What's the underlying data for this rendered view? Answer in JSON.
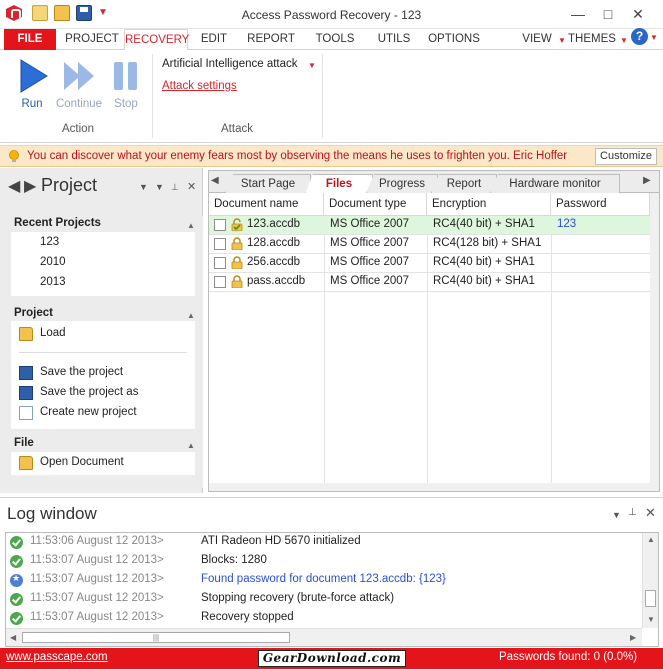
{
  "window": {
    "title": "Access Password Recovery - 123",
    "controls": {
      "minimize": "—",
      "maximize": "□",
      "close": "✕"
    }
  },
  "ribbon_tabs": [
    {
      "label": "FILE"
    },
    {
      "label": "PROJECT"
    },
    {
      "label": "RECOVERY",
      "active": true
    },
    {
      "label": "EDIT"
    },
    {
      "label": "REPORT"
    },
    {
      "label": "TOOLS"
    },
    {
      "label": "UTILS"
    },
    {
      "label": "OPTIONS"
    },
    {
      "label": "VIEW"
    },
    {
      "label": "THEMES"
    }
  ],
  "help": {
    "label": "?"
  },
  "ribbon": {
    "action_group": {
      "label": "Action",
      "run": "Run",
      "continue": "Continue",
      "stop": "Stop"
    },
    "attack_group": {
      "label": "Attack",
      "attack_type": "Artificial Intelligence attack",
      "settings_link": "Attack settings"
    }
  },
  "tip": {
    "text": "You can discover what your enemy fears most by observing the means he uses to frighten you. Eric Hoffer",
    "customize_label": "Customize"
  },
  "left_panel": {
    "title": "Project",
    "recent": {
      "heading": "Recent Projects",
      "items": [
        "123",
        "2010",
        "2013"
      ]
    },
    "project": {
      "heading": "Project",
      "items": [
        "Load",
        "Save the project",
        "Save the project as",
        "Create new project"
      ]
    },
    "file": {
      "heading": "File",
      "items": [
        "Open Document"
      ]
    }
  },
  "doc_tabs": [
    {
      "label": "Start Page"
    },
    {
      "label": "Files",
      "active": true
    },
    {
      "label": "Progress"
    },
    {
      "label": "Report"
    },
    {
      "label": "Hardware monitor"
    }
  ],
  "files_table": {
    "columns": [
      "Document name",
      "Document type",
      "Encryption",
      "Password"
    ],
    "rows": [
      {
        "name": "123.accdb",
        "type": "MS Office 2007",
        "encryption": "RC4(40 bit) + SHA1",
        "password": "123",
        "found": true
      },
      {
        "name": "128.accdb",
        "type": "MS Office 2007",
        "encryption": "RC4(128 bit) + SHA1",
        "password": "",
        "found": false
      },
      {
        "name": "256.accdb",
        "type": "MS Office 2007",
        "encryption": "RC4(40 bit) + SHA1",
        "password": "",
        "found": false
      },
      {
        "name": "pass.accdb",
        "type": "MS Office 2007",
        "encryption": "RC4(40 bit) + SHA1",
        "password": "",
        "found": false
      }
    ]
  },
  "log": {
    "title": "Log window",
    "entries": [
      {
        "time": "11:53:06 August 12 2013>",
        "message": "ATI Radeon HD 5670 initialized",
        "status": "ok"
      },
      {
        "time": "11:53:07 August 12 2013>",
        "message": "Blocks: 1280",
        "status": "ok"
      },
      {
        "time": "11:53:07 August 12 2013>",
        "message": "Found password for document 123.accdb: {123}",
        "status": "info"
      },
      {
        "time": "11:53:07 August 12 2013>",
        "message": "Stopping recovery (brute-force attack)",
        "status": "ok"
      },
      {
        "time": "11:53:07 August 12 2013>",
        "message": "Recovery stopped",
        "status": "ok"
      }
    ]
  },
  "status_bar": {
    "url": "www.passcape.com",
    "watermark": "GearDownload.com",
    "passwords_found": "Passwords found: 0 (0.0%)"
  },
  "colors": {
    "accent": "#e3151b",
    "tip_background": "#fbe8c9",
    "found_row": "#def7dc",
    "link_blue": "#2a4fd6",
    "run_blue": "#2b6fd6"
  }
}
